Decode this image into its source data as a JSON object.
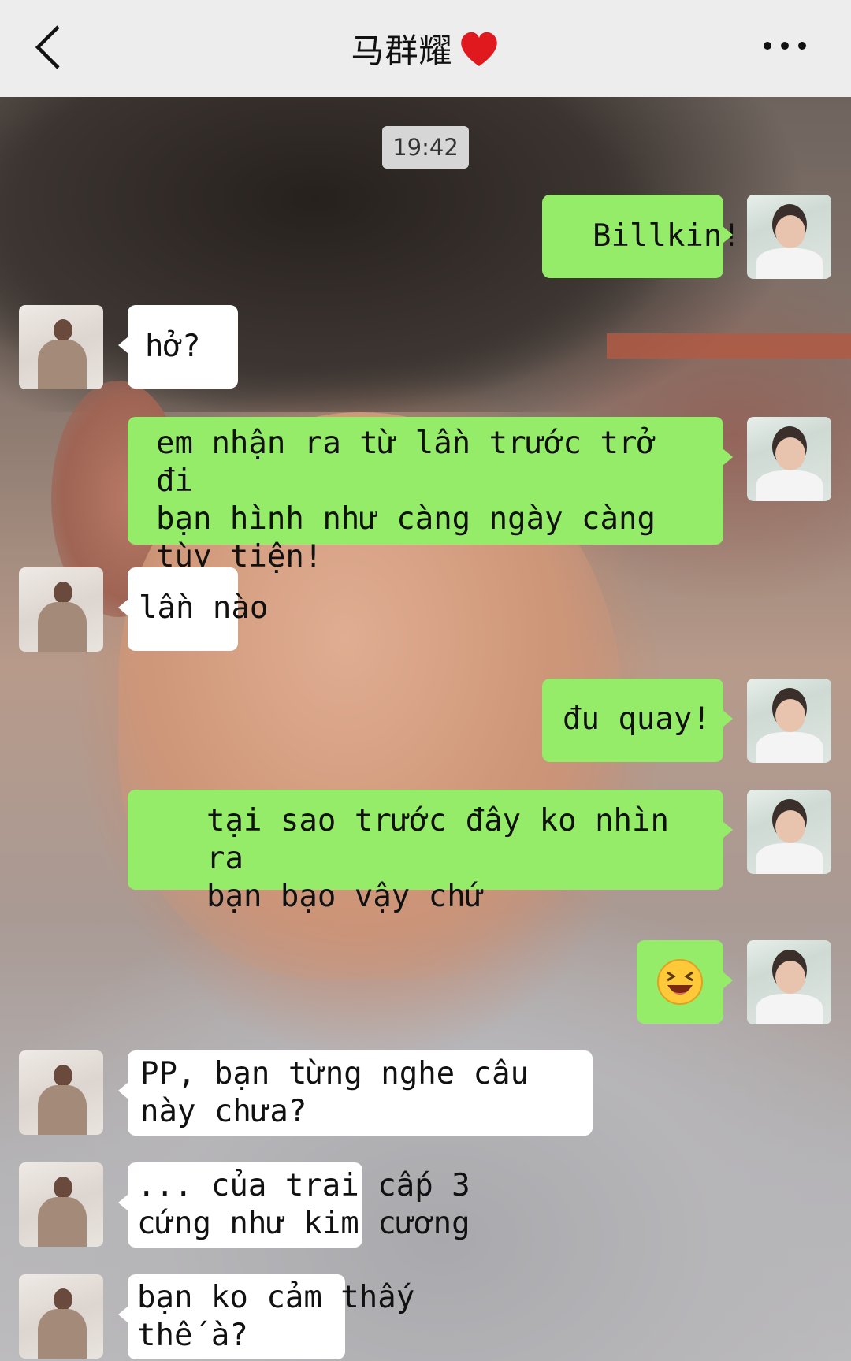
{
  "header": {
    "back_icon": "chevron-left-icon",
    "title": "马群耀",
    "title_icon": "heart-icon",
    "more_icon": "more-dots-icon",
    "title_icon_color": "#e0191f"
  },
  "chat": {
    "timestamp": "19:42",
    "messages": [
      {
        "side": "right",
        "lines": [
          "Billkin!"
        ]
      },
      {
        "side": "left",
        "lines": [
          "hở?"
        ]
      },
      {
        "side": "right",
        "lines": [
          "em nhận ra từ lần trước trở đi",
          "bạn hình như càng ngày càng",
          "tùy tiện!"
        ]
      },
      {
        "side": "left",
        "lines": [
          "lần nào"
        ]
      },
      {
        "side": "right",
        "lines": [
          "đu quay!"
        ]
      },
      {
        "side": "right",
        "lines": [
          "tại sao trước đây ko nhìn ra",
          "bạn bạo vậy chứ"
        ]
      },
      {
        "side": "right",
        "emoji": "😆",
        "emoji_name": "laughing-emoji"
      },
      {
        "side": "left",
        "lines": [
          "PP, bạn từng nghe câu",
          "này chưa?"
        ]
      },
      {
        "side": "left",
        "lines": [
          "... của trai cấp 3",
          "cứng như kim cương"
        ]
      },
      {
        "side": "left",
        "lines": [
          "bạn ko cảm thấy",
          "thế à?"
        ]
      }
    ],
    "colors": {
      "sent_bubble": "#95ec69",
      "received_bubble": "#ffffff",
      "header_bg": "#ededed"
    }
  }
}
